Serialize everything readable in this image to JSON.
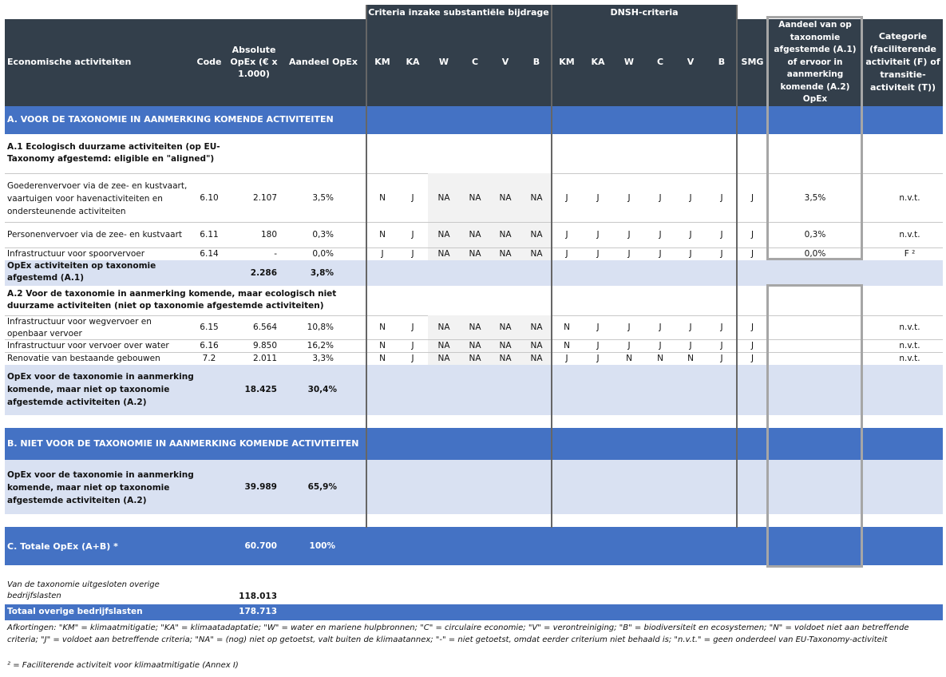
{
  "header": {
    "group_sc": "Criteria inzake substantiële bijdrage",
    "group_dnsh": "DNSH-criteria",
    "col_activity": "Economische activiteiten",
    "col_code": "Code",
    "col_abs": "Absolute OpEx (€ x 1.000)",
    "col_share": "Aandeel OpEx",
    "crit": [
      "KM",
      "KA",
      "W",
      "C",
      "V",
      "B"
    ],
    "col_smg": "SMG",
    "col_aligned": "Aandeel van op taxonomie afgestemde (A.1) of ervoor in aanmerking komende (A.2) OpEx",
    "col_category": "Categorie (faciliterende activiteit (F) of transitie-activiteit (T))"
  },
  "section_a": "A. VOOR DE TAXONOMIE IN AANMERKING KOMENDE ACTIVITEITEN",
  "a1": {
    "title": "A.1 Ecologisch duurzame activiteiten (op EU-Taxonomy afgestemd: eligible en \"aligned\")",
    "rows": [
      {
        "name": "Goederenvervoer via de zee- en kustvaart, vaartuigen voor havenactiviteiten en ondersteunende activiteiten",
        "code": "6.10",
        "abs": "2.107",
        "share": "3,5%",
        "sc": [
          "N",
          "J",
          "NA",
          "NA",
          "NA",
          "NA"
        ],
        "dnsh": [
          "J",
          "J",
          "J",
          "J",
          "J",
          "J"
        ],
        "smg": "J",
        "aligned": "3,5%",
        "cat": "n.v.t."
      },
      {
        "name": "Personenvervoer via de zee- en kustvaart",
        "code": "6.11",
        "abs": "180",
        "share": "0,3%",
        "sc": [
          "N",
          "J",
          "NA",
          "NA",
          "NA",
          "NA"
        ],
        "dnsh": [
          "J",
          "J",
          "J",
          "J",
          "J",
          "J"
        ],
        "smg": "J",
        "aligned": "0,3%",
        "cat": "n.v.t."
      },
      {
        "name": "Infrastructuur voor spoorvervoer",
        "code": "6.14",
        "abs": "-",
        "share": "0,0%",
        "sc": [
          "J",
          "J",
          "NA",
          "NA",
          "NA",
          "NA"
        ],
        "dnsh": [
          "J",
          "J",
          "J",
          "J",
          "J",
          "J"
        ],
        "smg": "J",
        "aligned": "0,0%",
        "cat": "F ²"
      }
    ],
    "total_label": "OpEx activiteiten op taxonomie afgestemd (A.1)",
    "total_abs": "2.286",
    "total_share": "3,8%"
  },
  "a2": {
    "title": "A.2 Voor de taxonomie in aanmerking komende, maar ecologisch niet duurzame activiteiten (niet op taxonomie afgestemde activiteiten)",
    "rows": [
      {
        "name": "Infrastructuur voor wegvervoer en openbaar vervoer",
        "code": "6.15",
        "abs": "6.564",
        "share": "10,8%",
        "sc": [
          "N",
          "J",
          "NA",
          "NA",
          "NA",
          "NA"
        ],
        "dnsh": [
          "N",
          "J",
          "J",
          "J",
          "J",
          "J"
        ],
        "smg": "J",
        "cat": "n.v.t."
      },
      {
        "name": "Infrastructuur voor vervoer over water",
        "code": "6.16",
        "abs": "9.850",
        "share": "16,2%",
        "sc": [
          "N",
          "J",
          "NA",
          "NA",
          "NA",
          "NA"
        ],
        "dnsh": [
          "N",
          "J",
          "J",
          "J",
          "J",
          "J"
        ],
        "smg": "J",
        "cat": "n.v.t."
      },
      {
        "name": "Renovatie van bestaande gebouwen",
        "code": "7.2",
        "abs": "2.011",
        "share": "3,3%",
        "sc": [
          "N",
          "J",
          "NA",
          "NA",
          "NA",
          "NA"
        ],
        "dnsh": [
          "J",
          "J",
          "N",
          "N",
          "N",
          "J"
        ],
        "smg": "J",
        "cat": "n.v.t."
      }
    ],
    "total_label": "OpEx voor de taxonomie in aanmerking komende, maar niet op taxonomie afgestemde activiteiten (A.2)",
    "total_abs": "18.425",
    "total_share": "30,4%"
  },
  "section_b": "B. NIET VOOR DE TAXONOMIE IN AANMERKING KOMENDE ACTIVITEITEN",
  "b_total": {
    "label": "OpEx voor de taxonomie in aanmerking komende, maar niet op taxonomie afgestemde activiteiten (A.2)",
    "abs": "39.989",
    "share": "65,9%"
  },
  "section_c": {
    "label": "C. Totale OpEx (A+B) *",
    "abs": "60.700",
    "share": "100%"
  },
  "excluded": {
    "label": "Van de taxonomie uitgesloten overige bedrijfslasten",
    "value": "118.013"
  },
  "total_other": {
    "label": "Totaal overige bedrijfslasten",
    "value": "178.713"
  },
  "footnote1": "Afkortingen: \"KM\" = klimaatmitigatie; \"KA\" = klimaatadaptatie; \"W\" = water en mariene hulpbronnen; \"C\" = circulaire economie; \"V\" = verontreiniging; \"B\" = biodiversiteit en ecosystemen; \"N\" = voldoet niet aan betreffende criteria; \"J\" = voldoet aan betreffende criteria; \"NA\" = (nog) niet op getoetst, valt buiten de klimaatannex; \"-\" = niet getoetst, omdat eerder criterium niet behaald is; \"n.v.t.\" = geen onderdeel van EU-Taxonomy-activiteit",
  "footnote2": "² = Faciliterende activiteit voor klimaatmitigatie (Annex I)",
  "colors": {
    "header": "#333f4b",
    "section": "#4472c4",
    "subtotal": "#d9e1f2",
    "na_shade": "#f2f2f2",
    "highlight_border": "#a6a6a6"
  }
}
